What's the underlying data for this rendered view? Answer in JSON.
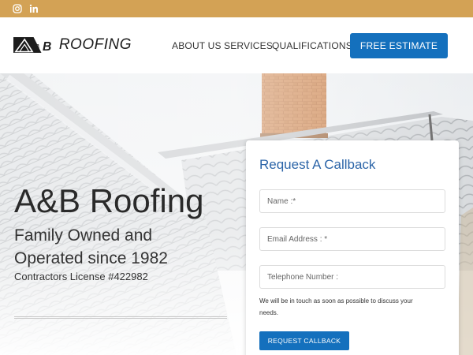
{
  "topbar": {
    "icons": [
      "instagram-icon",
      "linkedin-icon"
    ],
    "background": "#d3a255"
  },
  "header": {
    "logo_text": "ROOFING",
    "logo_mark": "A&B",
    "nav": [
      "ABOUT US",
      "SERVICES",
      "QUALIFICATIONS"
    ],
    "cta_label": "FREE ESTIMATE",
    "accent": "#1470bd"
  },
  "hero": {
    "title": "A&B Roofing",
    "subtitle": "Family Owned and Operated since 1982",
    "license": "Contractors License #422982"
  },
  "form": {
    "title": "Request A Callback",
    "name_placeholder": "Name :*",
    "email_placeholder": "Email Address : *",
    "phone_placeholder": "Telephone Number :",
    "note": "We will be in touch as soon as possible to discuss your needs.",
    "submit_label": "REQUEST CALLBACK",
    "title_color": "#2c65a8"
  }
}
